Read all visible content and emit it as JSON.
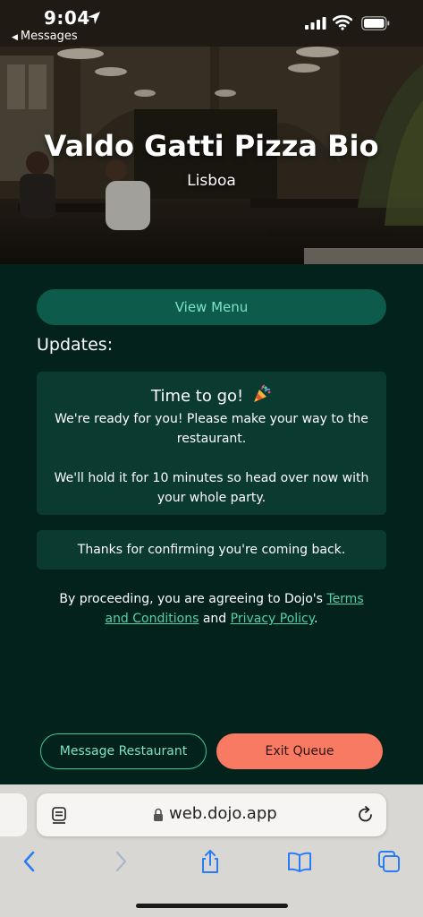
{
  "status_bar": {
    "time": "9:04",
    "back_app": "Messages",
    "icons": [
      "location-arrow-icon",
      "cellular-signal-icon",
      "wifi-icon",
      "battery-icon"
    ]
  },
  "hero": {
    "restaurant_name": "Valdo Gatti Pizza Bio",
    "city": "Lisboa"
  },
  "main": {
    "view_menu_label": "View Menu",
    "updates_heading": "Updates:",
    "update_card": {
      "title": "Time to go!",
      "icon": "party-popper-icon",
      "paragraph_1": "We're ready for you! Please make your way to the restaurant.",
      "paragraph_2": "We'll hold it for 10 minutes so head over now with your whole party."
    },
    "confirmation_text": "Thanks for confirming you're coming back.",
    "legal": {
      "prefix": "By proceeding, you are agreeing to Dojo's ",
      "terms_link": "Terms and Conditions",
      "middle": " and ",
      "privacy_link": "Privacy Policy",
      "suffix": "."
    }
  },
  "actions": {
    "message_label": "Message Restaurant",
    "exit_label": "Exit Queue"
  },
  "browser": {
    "url": "web.dojo.app",
    "toolbar": [
      "back-icon",
      "forward-icon",
      "share-icon",
      "bookmarks-icon",
      "tabs-icon"
    ]
  },
  "colors": {
    "background": "#03221c",
    "primary_button": "#0d5b4a",
    "accent_text": "#7ee3c4",
    "link": "#4fd2a8",
    "exit_button": "#f97a62",
    "card": "#0a3a30"
  }
}
